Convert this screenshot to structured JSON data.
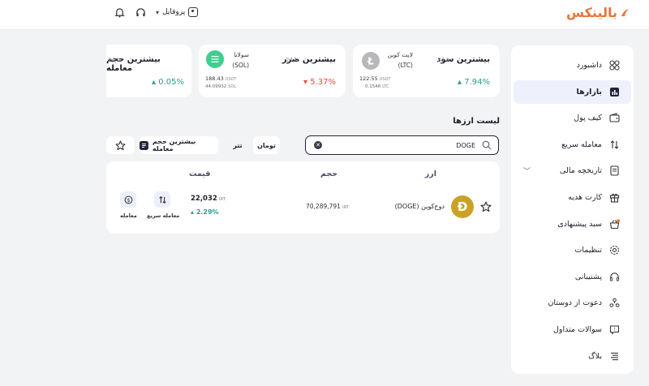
{
  "app": {
    "logo_text": "بالینکس"
  },
  "topbar": {
    "profile_label": "پروفایل"
  },
  "colors": {
    "accent": "#e8743b",
    "positive": "#2a9d8f",
    "negative": "#e74c3c",
    "active_bg": "#eef0fb"
  },
  "sidebar": {
    "items": [
      {
        "label": "داشبورد",
        "icon": "grid-icon"
      },
      {
        "label": "بازارها",
        "icon": "chart-icon"
      },
      {
        "label": "کیف پول",
        "icon": "wallet-icon"
      },
      {
        "label": "معامله سریع",
        "icon": "swap-icon"
      },
      {
        "label": "تاریخچه مالی",
        "icon": "receipt-icon"
      },
      {
        "label": "کارت هدیه",
        "icon": "gift-icon"
      },
      {
        "label": "سبد پیشنهادی",
        "icon": "basket-icon"
      },
      {
        "label": "تنظیمات",
        "icon": "gear-icon"
      },
      {
        "label": "پشتیبانی",
        "icon": "headset-icon"
      },
      {
        "label": "دعوت از دوستان",
        "icon": "users-icon"
      },
      {
        "label": "سوالات متداول",
        "icon": "question-icon"
      },
      {
        "label": "بلاگ",
        "icon": "list-icon"
      }
    ]
  },
  "cards": {
    "top_gainer": {
      "title": "بیشترین سود",
      "period": "24 h",
      "change": "7.94%",
      "coin_name": "لایت کوین",
      "coin_symbol": "(LTC)",
      "price": "122.55",
      "price_unit": "USDT",
      "sub_value": "0.1546",
      "sub_unit": "LTC"
    },
    "top_loser": {
      "title": "بیشترین ضرر",
      "period": "24 h",
      "change": "5.37%",
      "coin_name": "سولانا",
      "coin_symbol": "(SOL)",
      "price": "188.43",
      "price_unit": "USDT",
      "sub_value": "44.09932",
      "sub_unit": "SOL"
    },
    "top_volume": {
      "title": "بیشترین حجم معامله",
      "period": "24 h",
      "change": "0.05%"
    }
  },
  "list": {
    "title": "لیست ارزها",
    "search_value": "DOGE",
    "filters": [
      "تومان",
      "تتر"
    ],
    "sort_label": "بیشترین حجم معامله",
    "columns": {
      "currency": "ارز",
      "volume": "حجم",
      "price": "قیمت"
    },
    "rows": [
      {
        "icon": "doge-icon",
        "name": "دوج‌کوین",
        "symbol": "(DOGE)",
        "volume": "70,289,791",
        "volume_unit": "IRT",
        "price": "22,032",
        "price_unit": "IRT",
        "change": "2.29%",
        "actions": {
          "trade": "معامله",
          "quick_trade": "معامله سریع"
        }
      }
    ]
  }
}
